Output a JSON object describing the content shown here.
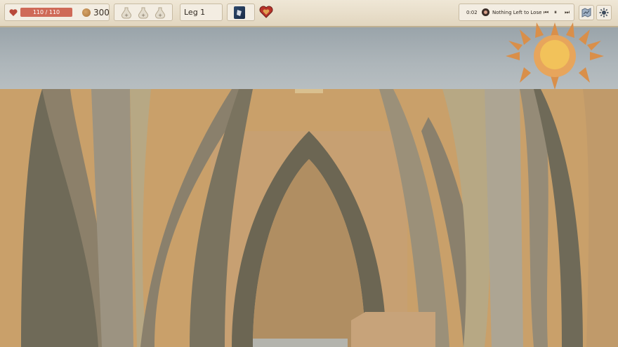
{
  "hud": {
    "health": {
      "current": 110,
      "max": 110,
      "text": "110 / 110",
      "fill_fraction": 1.0
    },
    "gold": "300",
    "potion_slots": [
      {
        "name": "empty-potion-slot"
      },
      {
        "name": "empty-potion-slot"
      },
      {
        "name": "empty-potion-slot"
      }
    ],
    "leg": "Leg 1",
    "music": {
      "elapsed": "0:02",
      "track": "Nothing Left to Lose",
      "prev": "⏮",
      "pause": "⏸",
      "next": "⏭"
    }
  },
  "colors": {
    "hud_bg": "#efe7d6",
    "health_fill": "#cf6a58",
    "sky": "#aeb6ba",
    "paper_tan": "#c9a06a",
    "sun_outer": "#d98f4a",
    "sun_inner": "#f2c25a"
  },
  "icons": [
    "heart-icon",
    "coin-icon",
    "potion-icon",
    "deck-icon",
    "relic-heart-icon",
    "disc-icon",
    "map-icon",
    "settings-icon",
    "sun-icon"
  ]
}
